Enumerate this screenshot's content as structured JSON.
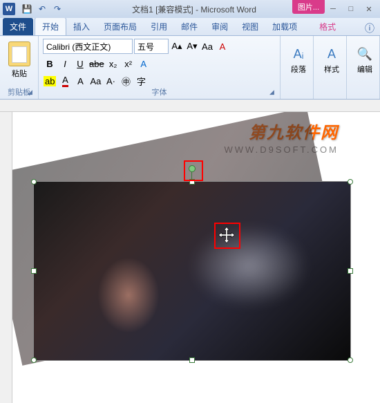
{
  "titlebar": {
    "app_icon": "W",
    "title": "文档1 [兼容模式] - Microsoft Word",
    "picture_tools": "图片..."
  },
  "tabs": {
    "file": "文件",
    "home": "开始",
    "insert": "插入",
    "layout": "页面布局",
    "references": "引用",
    "mailings": "邮件",
    "review": "审阅",
    "view": "视图",
    "addins": "加载项",
    "format": "格式"
  },
  "ribbon": {
    "clipboard": {
      "paste": "粘贴",
      "label": "剪贴板"
    },
    "font": {
      "name": "Calibri (西文正文)",
      "size": "五号",
      "label": "字体",
      "bold": "B",
      "italic": "I",
      "underline": "U",
      "strike": "abe",
      "sub": "x₂",
      "sup": "x²",
      "grow": "A",
      "shrink": "A",
      "case": "Aa",
      "clear": "A"
    },
    "paragraph": {
      "label": "段落",
      "btn": "段落"
    },
    "styles": {
      "label": "样式",
      "btn": "样式"
    },
    "editing": {
      "label": "编辑",
      "btn": "编辑"
    }
  },
  "watermark": {
    "text": "第九软件网",
    "url": "WWW.D9SOFT.COM"
  }
}
